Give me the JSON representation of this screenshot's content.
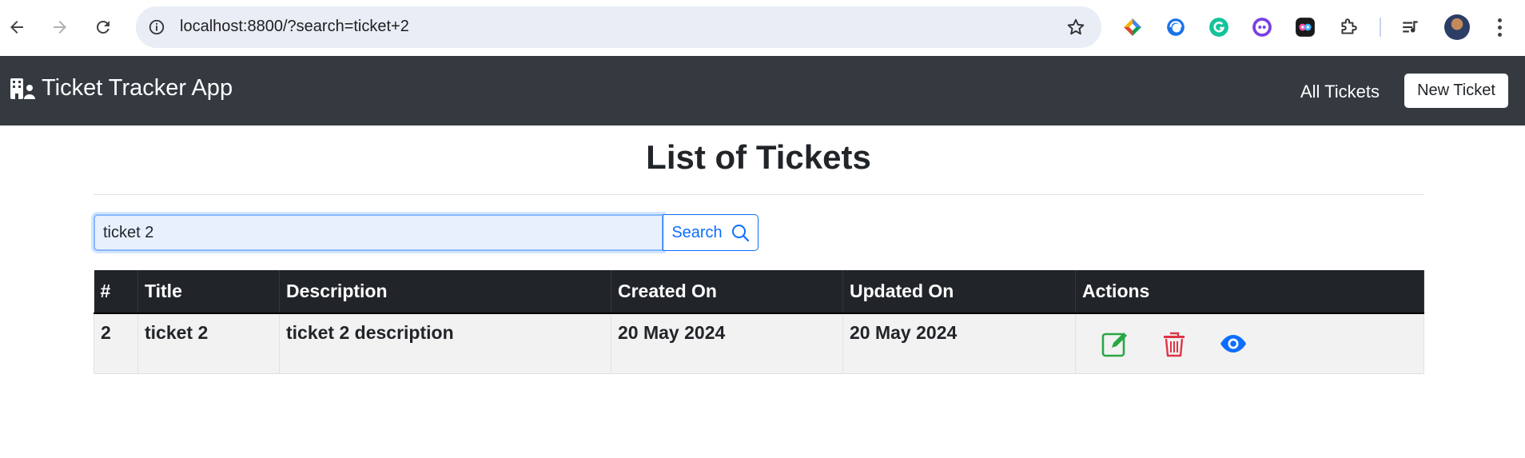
{
  "browser": {
    "url": "localhost:8800/?search=ticket+2",
    "extensions": [
      "colorful-diamond-icon",
      "edge-copilot-icon",
      "grammarly-icon",
      "cute-face-icon",
      "bitmoji-icon",
      "puzzle-icon",
      "reading-list-icon"
    ]
  },
  "navbar": {
    "brand": "Ticket Tracker App",
    "all_tickets": "All Tickets",
    "new_ticket": "New Ticket"
  },
  "page": {
    "title": "List of Tickets"
  },
  "search": {
    "value": "ticket 2",
    "button_label": "Search"
  },
  "table": {
    "headers": [
      "#",
      "Title",
      "Description",
      "Created On",
      "Updated On",
      "Actions"
    ],
    "rows": [
      {
        "id": "2",
        "title": "ticket 2",
        "description": "ticket 2 description",
        "created_on": "20 May 2024",
        "updated_on": "20 May 2024"
      }
    ]
  },
  "colors": {
    "navbar_bg": "#343a40",
    "table_header_bg": "#212529",
    "primary": "#0d6efd",
    "edit": "#28a745",
    "delete": "#dc3545",
    "view": "#0d6efd"
  }
}
